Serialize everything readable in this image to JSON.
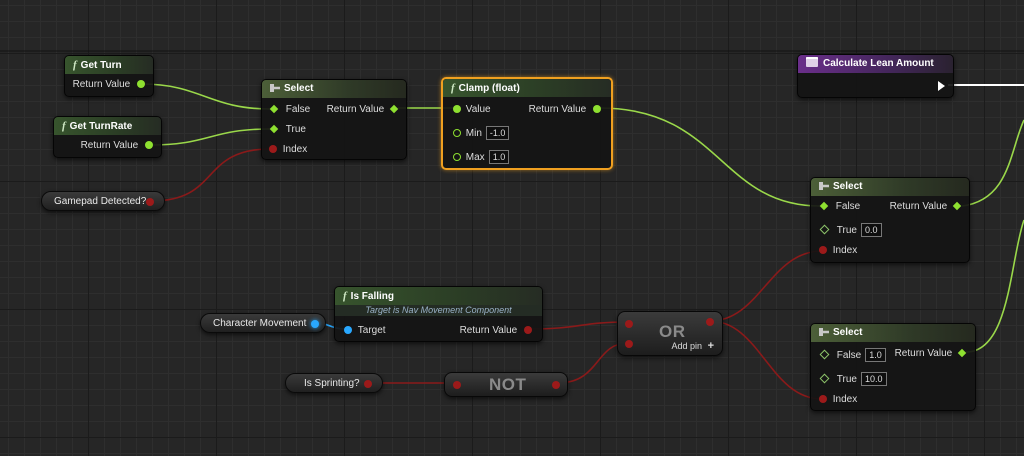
{
  "nodes": {
    "get_turn": {
      "title": "Get Turn",
      "return_value": "Return Value"
    },
    "get_turnrate": {
      "title": "Get TurnRate",
      "return_value": "Return Value"
    },
    "select1": {
      "title": "Select",
      "false": "False",
      "true": "True",
      "index": "Index",
      "return_value": "Return Value"
    },
    "clamp": {
      "title": "Clamp (float)",
      "value": "Value",
      "return_value": "Return Value",
      "min": "Min",
      "min_val": "-1.0",
      "max": "Max",
      "max_val": "1.0"
    },
    "calc_lean": {
      "title": "Calculate Lean Amount"
    },
    "select2": {
      "title": "Select",
      "false": "False",
      "true": "True",
      "true_val": "0.0",
      "index": "Index",
      "return_value": "Return Value"
    },
    "select3": {
      "title": "Select",
      "false": "False",
      "false_val": "1.0",
      "true": "True",
      "true_val": "10.0",
      "index": "Index",
      "return_value": "Return Value"
    },
    "is_falling": {
      "title": "Is Falling",
      "subtitle": "Target is Nav Movement Component",
      "target": "Target",
      "return_value": "Return Value"
    },
    "gamepad_detected": {
      "label": "Gamepad Detected?"
    },
    "character_movement": {
      "label": "Character Movement"
    },
    "is_sprinting": {
      "label": "Is Sprinting?"
    },
    "or_node": {
      "label": "OR",
      "add_pin": "Add pin"
    },
    "not_node": {
      "label": "NOT"
    }
  },
  "colors": {
    "float_pin": "#8ee030",
    "bool_pin": "#9c1a1a",
    "object_pin": "#29a8ff",
    "selected_outline": "#f0a020",
    "function_header": "#37542d",
    "event_header": "#6a2e8a"
  }
}
